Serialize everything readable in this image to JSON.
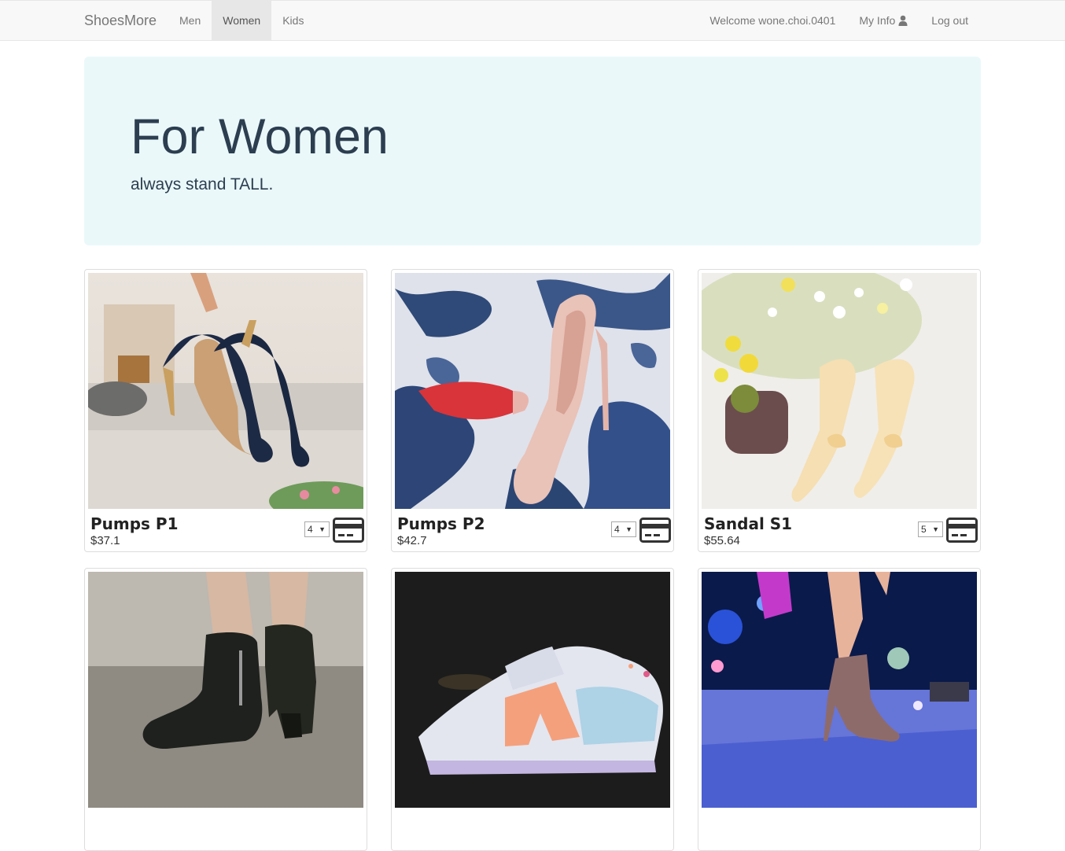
{
  "navbar": {
    "brand": "ShoesMore",
    "left_items": [
      {
        "label": "Men"
      },
      {
        "label": "Women"
      },
      {
        "label": "Kids"
      }
    ],
    "welcome": "Welcome wone.choi.0401",
    "my_info": "My Info",
    "logout": "Log out",
    "user_icon": "user-icon"
  },
  "hero": {
    "title": "For Women",
    "subtitle": "always stand TALL."
  },
  "products": [
    {
      "name": "Pumps P1",
      "price": "$37.1",
      "qty": "4",
      "image": "navy-pumps-held-by-hand"
    },
    {
      "name": "Pumps P2",
      "price": "$42.7",
      "qty": "4",
      "image": "pink-pumps-on-floral-sheet"
    },
    {
      "name": "Sandal S1",
      "price": "$55.64",
      "qty": "5",
      "image": "cream-bow-slingback-with-flowers"
    },
    {
      "image": "black-ankle-boots"
    },
    {
      "image": "white-peach-sneakers"
    },
    {
      "image": "glitter-ankle-boot-on-stage"
    }
  ],
  "colors": {
    "navbar_bg": "#f8f8f8",
    "active_tab_bg": "#e7e7e7",
    "hero_bg": "#eaf8fa",
    "hero_text": "#2c3e50"
  }
}
